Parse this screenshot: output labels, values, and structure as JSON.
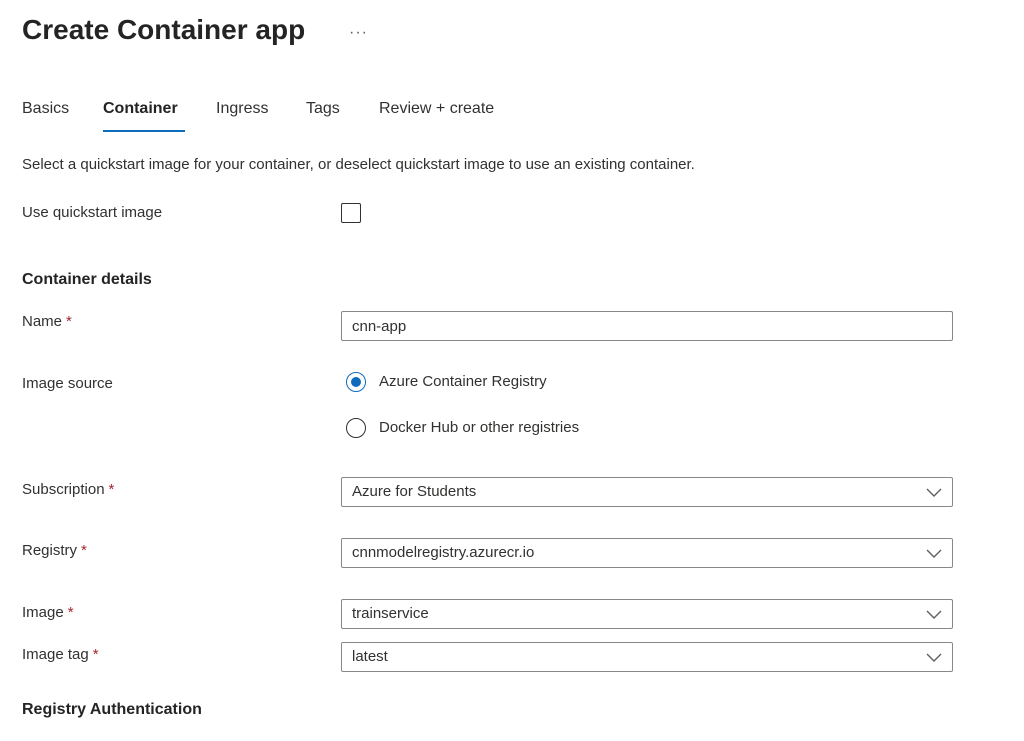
{
  "header": {
    "title": "Create Container app",
    "more_label": "···"
  },
  "tabs": [
    {
      "label": "Basics",
      "active": false
    },
    {
      "label": "Container",
      "active": true
    },
    {
      "label": "Ingress",
      "active": false
    },
    {
      "label": "Tags",
      "active": false
    },
    {
      "label": "Review + create",
      "active": false
    }
  ],
  "intro": "Select a quickstart image for your container, or deselect quickstart image to use an existing container.",
  "quickstart": {
    "label": "Use quickstart image",
    "checked": false
  },
  "sections": {
    "container_details": "Container details",
    "registry_auth": "Registry Authentication"
  },
  "required_marker": "*",
  "fields": {
    "name": {
      "label": "Name",
      "value": "cnn-app"
    },
    "image_source": {
      "label": "Image source",
      "options": [
        "Azure Container Registry",
        "Docker Hub or other registries"
      ],
      "selected": "Azure Container Registry"
    },
    "subscription": {
      "label": "Subscription",
      "value": "Azure for Students"
    },
    "registry": {
      "label": "Registry",
      "value": "cnnmodelregistry.azurecr.io"
    },
    "image": {
      "label": "Image",
      "value": "trainservice"
    },
    "image_tag": {
      "label": "Image tag",
      "value": "latest"
    }
  },
  "icons": {
    "select_arrow": "chevron-down-icon",
    "more": "ellipsis-icon"
  },
  "colors": {
    "accent": "#0f6cbd",
    "required": "#a4262c",
    "border": "#8a8886"
  }
}
